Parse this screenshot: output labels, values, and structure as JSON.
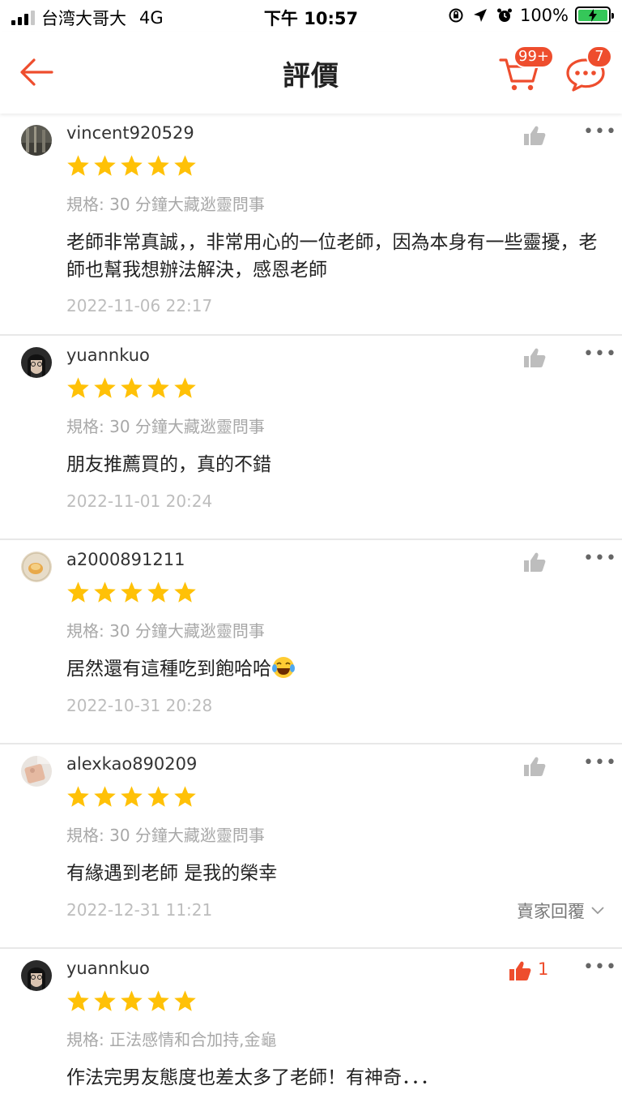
{
  "status_bar": {
    "carrier": "台湾大哥大",
    "network": "4G",
    "time": "下午 10:57",
    "battery": "100%"
  },
  "header": {
    "title": "評價",
    "cart_badge": "99+",
    "chat_badge": "7"
  },
  "colors": {
    "accent": "#ee4d2d",
    "star": "#ffc107",
    "muted": "#a8a8a8",
    "divider": "#e8e8e8"
  },
  "reviews": [
    {
      "username": "vincent920529",
      "rating": 5,
      "variation": "規格: 30 分鐘大藏逖靈問事",
      "comment": "老師非常真誠，，非常用心的一位老師，因為本身有一些靈擾，老師也幫我想辦法解決，感恩老師",
      "date": "2022-11-06 22:17",
      "likes": ""
    },
    {
      "username": "yuannkuo",
      "rating": 5,
      "variation": "規格: 30 分鐘大藏逖靈問事",
      "comment": "朋友推薦買的，真的不錯",
      "date": "2022-11-01 20:24",
      "likes": ""
    },
    {
      "username": "a2000891211",
      "rating": 5,
      "variation": "規格: 30 分鐘大藏逖靈問事",
      "comment": "居然還有這種吃到飽哈哈",
      "date": "2022-10-31 20:28",
      "likes": ""
    },
    {
      "username": "alexkao890209",
      "rating": 5,
      "variation": "規格: 30 分鐘大藏逖靈問事",
      "comment": "有緣遇到老師 是我的榮幸",
      "date": "2022-12-31 11:21",
      "likes": "",
      "seller_reply_label": "賣家回覆"
    },
    {
      "username": "yuannkuo",
      "rating": 5,
      "variation": "規格: 正法感情和合加持,金龜",
      "comment": "作法完男友態度也差太多了老師！有神奇．．．",
      "date": "",
      "likes": "1"
    }
  ]
}
